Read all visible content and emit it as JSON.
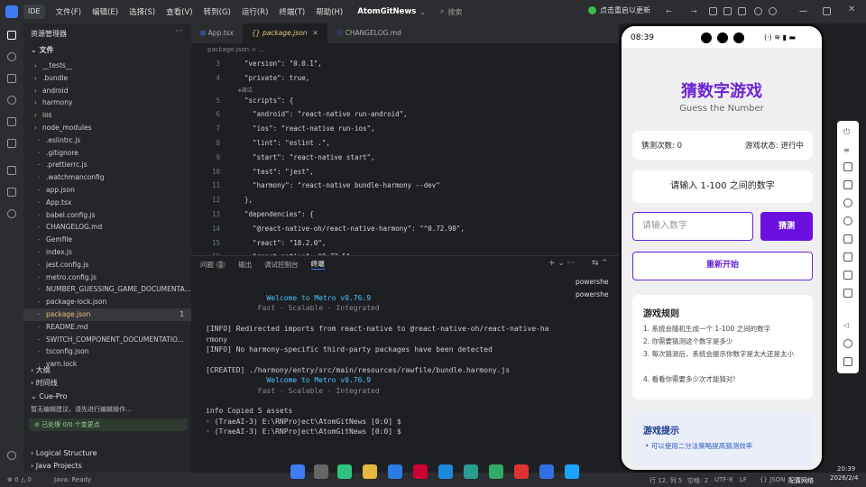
{
  "titlebar": {
    "ide_tag": "IDE",
    "menus": [
      "文件(F)",
      "编辑(E)",
      "选择(S)",
      "查看(V)",
      "转到(G)",
      "运行(R)",
      "终端(T)",
      "帮助(H)"
    ],
    "project": "AtomGitNews",
    "search_placeholder": "搜索",
    "notify_text": "点击重启以更新"
  },
  "sidebar": {
    "title": "资源管理器",
    "section": "文件",
    "items": [
      {
        "label": "__tests__",
        "type": "folder"
      },
      {
        "label": ".bundle",
        "type": "folder"
      },
      {
        "label": "android",
        "type": "folder"
      },
      {
        "label": "harmony",
        "type": "folder"
      },
      {
        "label": "ios",
        "type": "folder"
      },
      {
        "label": "node_modules",
        "type": "folder"
      },
      {
        "label": ".eslintrc.js",
        "type": "file"
      },
      {
        "label": ".gitignore",
        "type": "file"
      },
      {
        "label": ".prettierrc.js",
        "type": "file"
      },
      {
        "label": ".watchmanconfig",
        "type": "file"
      },
      {
        "label": "app.json",
        "type": "file"
      },
      {
        "label": "App.tsx",
        "type": "file"
      },
      {
        "label": "babel.config.js",
        "type": "file"
      },
      {
        "label": "CHANGELOG.md",
        "type": "file"
      },
      {
        "label": "Gemfile",
        "type": "file"
      },
      {
        "label": "index.js",
        "type": "file"
      },
      {
        "label": "jest.config.js",
        "type": "file"
      },
      {
        "label": "metro.config.js",
        "type": "file"
      },
      {
        "label": "NUMBER_GUESSING_GAME_DOCUMENTA...",
        "type": "file"
      },
      {
        "label": "package-lock.json",
        "type": "file"
      },
      {
        "label": "package.json",
        "type": "file",
        "badge": "1"
      },
      {
        "label": "README.md",
        "type": "file"
      },
      {
        "label": "SWITCH_COMPONENT_DOCUMENTATIO...",
        "type": "file"
      },
      {
        "label": "tsconfig.json",
        "type": "file"
      },
      {
        "label": "yarn.lock",
        "type": "file"
      }
    ],
    "outline": "大纲",
    "timeline": "时间线",
    "cue_title": "Cue-Pro",
    "cue_msg": "暂无编辑建议，请先进行编辑操作...",
    "cue_status": "已处理 0/0 个变更点",
    "logical": "Logical Structure",
    "java": "Java Projects"
  },
  "editor": {
    "tabs": [
      "App.tsx",
      "package.json",
      "CHANGELOG.md"
    ],
    "active_tab": "package.json",
    "breadcrumb": "package.json > ...",
    "debug_hint": "⊕调试",
    "lines": [
      {
        "n": "3",
        "t": "  \"version\": \"0.0.1\","
      },
      {
        "n": "4",
        "t": "  \"private\": true,"
      },
      {
        "n": "5",
        "t": "  \"scripts\": {"
      },
      {
        "n": "6",
        "t": "    \"android\": \"react-native run-android\","
      },
      {
        "n": "7",
        "t": "    \"ios\": \"react-native run-ios\","
      },
      {
        "n": "8",
        "t": "    \"lint\": \"eslint .\","
      },
      {
        "n": "9",
        "t": "    \"start\": \"react-native start\","
      },
      {
        "n": "10",
        "t": "    \"test\": \"jest\","
      },
      {
        "n": "11",
        "t": "    \"harmony\": \"react-native bundle-harmony --dev\""
      },
      {
        "n": "12",
        "t": "  },"
      },
      {
        "n": "13",
        "t": "  \"dependencies\": {"
      },
      {
        "n": "14",
        "t": "    \"@react-native-oh/react-native-harmony\": \"^0.72.90\","
      },
      {
        "n": "15",
        "t": "    \"react\": \"18.2.0\","
      },
      {
        "n": "16",
        "t": "    \"react-native\": \"0.72.5\""
      },
      {
        "n": "17",
        "t": "  }"
      }
    ]
  },
  "panel": {
    "tabs": [
      "问题",
      "输出",
      "调试控制台",
      "终端"
    ],
    "problems_count": "1",
    "terminal_lines": [
      {
        "t": "              Welcome to Metro v0.76.9",
        "c": "blue"
      },
      {
        "t": "            Fast - Scalable - Integrated",
        "c": "dim"
      },
      {
        "t": "",
        "c": ""
      },
      {
        "t": "[INFO] Redirected imports from react-native to @react-native-oh/react-native-ha",
        "c": ""
      },
      {
        "t": "rmony",
        "c": ""
      },
      {
        "t": "[INFO] No harmony-specific third-party packages have been detected",
        "c": ""
      },
      {
        "t": "",
        "c": ""
      },
      {
        "t": "[CREATED] ./harmony/entry/src/main/resources/rawfile/bundle.harmony.js",
        "c": ""
      },
      {
        "t": "              Welcome to Metro v0.76.9",
        "c": "blue"
      },
      {
        "t": "            Fast - Scalable - Integrated",
        "c": "dim"
      },
      {
        "t": "",
        "c": ""
      },
      {
        "t": "info Copied 5 assets",
        "c": ""
      },
      {
        "t": "◦ (TraeAI-3) E:\\RNProject\\AtomGitNews [0:0] $",
        "c": ""
      },
      {
        "t": "◦ (TraeAI-3) E:\\RNProject\\AtomGitNews [0:0] $",
        "c": ""
      }
    ],
    "shells": [
      "powershe",
      "powershe"
    ]
  },
  "phone": {
    "time": "08:39",
    "title": "猜数字游戏",
    "subtitle": "Guess the Number",
    "guess_count": "猜测次数: 0",
    "game_status": "游戏状态: 进行中",
    "prompt": "请输入 1-100 之间的数字",
    "input_placeholder": "请输入数字",
    "guess_button": "猜测",
    "restart_button": "重新开始",
    "rules_title": "游戏规则",
    "rules": [
      "1. 系统会随机生成一个 1-100 之间的数字",
      "2. 你需要猜测这个数字是多少",
      "3. 每次猜测后，系统会提示你数字是太大还是太小",
      "4. 看看你需要多少次才能猜对!"
    ],
    "tips_title": "游戏提示",
    "tip": "• 可以使用二分法策略提高猜测效率"
  },
  "statusbar": {
    "java": "Java: Ready",
    "position": "行 12, 列 5",
    "spaces": "空格: 2",
    "encoding": "UTF-8",
    "eol": "LF",
    "lang": "{} JSON",
    "config": "配置网络",
    "time": "20:39",
    "date": "2026/2/4",
    "errors": "0",
    "warnings": "0"
  },
  "colors": {
    "accent": "#6c24d4",
    "button": "#6b0fde"
  }
}
